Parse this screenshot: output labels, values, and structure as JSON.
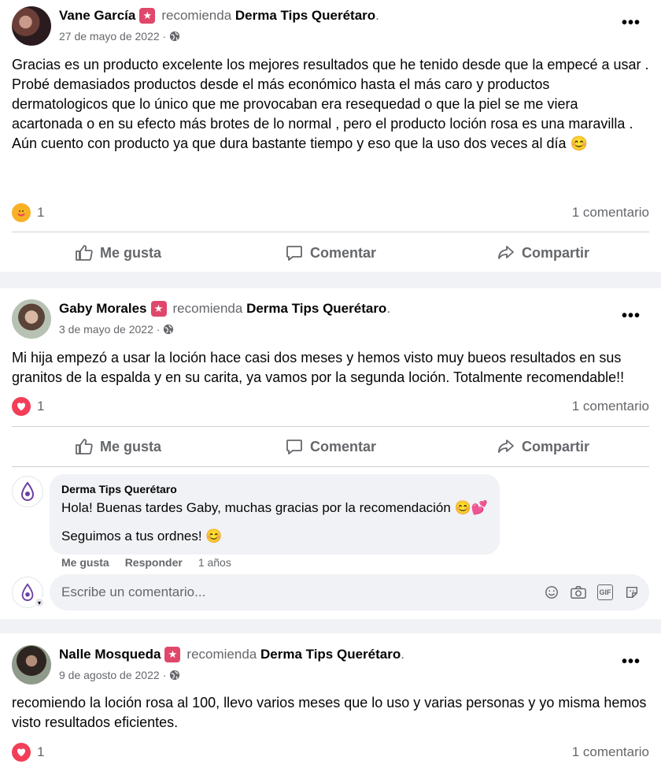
{
  "posts": [
    {
      "author": "Vane García",
      "recommends_text": "recomienda",
      "page": "Derma Tips Querétaro",
      "date": "27 de mayo de 2022",
      "more": "•••",
      "text_lines": [
        "Gracias  es un producto excelente  los mejores resultados que he tenido desde que la empecé a usar .",
        "Probé demasiados productos desde el más económico hasta el más caro y productos dermatologicos que lo único que me provocaban era resequedad o que la piel se me viera acartonada o en su efecto más brotes  de lo normal , pero el producto loción rosa es una maravilla .",
        "Aún cuento con producto  ya que dura bastante tiempo  y eso que la uso dos veces al día  😊"
      ],
      "reaction_icon": "care-reaction-icon",
      "reaction_count": "1",
      "comments_count": "1 comentario"
    },
    {
      "author": "Gaby Morales",
      "recommends_text": "recomienda",
      "page": "Derma Tips Querétaro",
      "date": "3 de mayo de 2022",
      "more": "•••",
      "text_lines": [
        "Mi hija empezó a usar la loción hace casi dos meses y hemos visto muy bueos resultados en sus granitos de la espalda y en su carita, ya vamos por la segunda loción. Totalmente recomendable!!"
      ],
      "reaction_icon": "love-reaction-icon",
      "reaction_count": "1",
      "comments_count": "1 comentario",
      "reply": {
        "author": "Derma Tips Querétaro",
        "line1": "Hola! Buenas tardes Gaby, muchas gracias por la recomendación 😊💕",
        "line2": "Seguimos a tus ordnes! 😊",
        "like": "Me gusta",
        "respond": "Responder",
        "age": "1 años"
      },
      "composer": {
        "placeholder": "Escribe un comentario...",
        "gif_label": "GIF"
      }
    },
    {
      "author": "Nalle Mosqueda",
      "recommends_text": "recomienda",
      "page": "Derma Tips Querétaro",
      "date": "9 de agosto de 2022",
      "more": "•••",
      "text_lines": [
        "recomiendo la loción rosa al 100, llevo varios meses que lo uso y varias personas y yo misma hemos visto resultados eficientes."
      ],
      "reaction_icon": "love-reaction-icon",
      "reaction_count": "1",
      "comments_count": "1 comentario"
    }
  ],
  "actions": {
    "like": "Me gusta",
    "comment": "Comentar",
    "share": "Compartir"
  },
  "badge_glyph": "★",
  "date_separator": "·",
  "colors": {
    "badge": "#e0486b",
    "love": "#f33e58",
    "care": "#f7b125",
    "secondary_text": "#65676b"
  }
}
